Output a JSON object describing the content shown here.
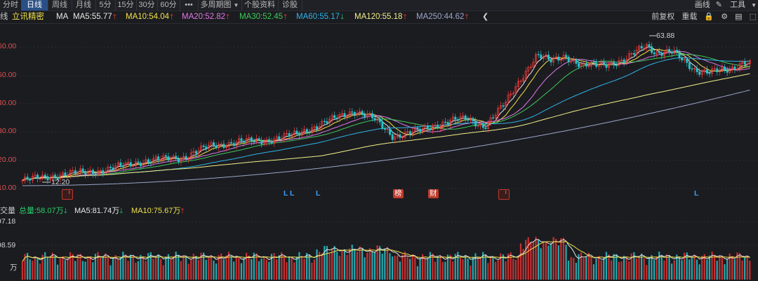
{
  "toolbar": {
    "tabs": [
      {
        "label": "分时",
        "active": false
      },
      {
        "label": "日线",
        "active": true
      },
      {
        "label": "周线",
        "active": false
      },
      {
        "label": "月线",
        "active": false
      },
      {
        "label": "5分",
        "active": false
      },
      {
        "label": "15分",
        "active": false
      },
      {
        "label": "30分",
        "active": false
      },
      {
        "label": "60分",
        "active": false
      },
      {
        "label": "•••",
        "active": false
      },
      {
        "label": "多周期图",
        "active": false
      },
      {
        "label": "个股资料",
        "active": false
      },
      {
        "label": "诊股",
        "active": false
      }
    ],
    "right": {
      "draw": "画线",
      "tools": "工具"
    }
  },
  "ma_bar": {
    "prefix": "线",
    "indicator": "立讯精密",
    "ma_label": "MA",
    "items": [
      {
        "text": "MA5:55.77",
        "color": "#e8e8e8",
        "dir": "up"
      },
      {
        "text": "MA10:54.04",
        "color": "#f0e24a",
        "dir": "up"
      },
      {
        "text": "MA20:52.82",
        "color": "#e178e8",
        "dir": "up"
      },
      {
        "text": "MA30:52.45",
        "color": "#3ec95a",
        "dir": "up"
      },
      {
        "text": "MA60:55.17",
        "color": "#2fb3e8",
        "dir": "down"
      },
      {
        "text": "MA120:55.18",
        "color": "#f3f08a",
        "dir": "up"
      },
      {
        "text": "MA250:44.62",
        "color": "#9aa6c8",
        "dir": "up"
      }
    ],
    "right_tools": {
      "adjust": "前复权",
      "overlay": "重载"
    }
  },
  "price_axis": {
    "labels": [
      "60.00",
      "50.00",
      "40.00",
      "30.00",
      "20.00",
      "10.00"
    ]
  },
  "annotations": {
    "high": "63.88",
    "low": "12.20"
  },
  "badges": [
    {
      "text": "ᅵ",
      "kind": "redo"
    },
    {
      "text": "L",
      "kind": "blueL"
    },
    {
      "text": "L",
      "kind": "blueL"
    },
    {
      "text": "L",
      "kind": "blueL"
    },
    {
      "text": "榜",
      "kind": "red"
    },
    {
      "text": "财",
      "kind": "red"
    },
    {
      "text": "ᅵ",
      "kind": "redo"
    },
    {
      "text": "L",
      "kind": "blueL"
    }
  ],
  "volume_bar": {
    "title": "交量",
    "total": "总量:58.07万",
    "total_dir": "down",
    "ma5": "MA5:81.74万",
    "ma5_dir": "down",
    "ma10": "MA10:75.67万",
    "ma10_dir": "up"
  },
  "volume_axis": {
    "labels": [
      "97.18",
      "98.59",
      "万"
    ]
  },
  "colors": {
    "up": "#ff3b3b",
    "down": "#27d06a",
    "accent": "#2a4f86"
  }
}
